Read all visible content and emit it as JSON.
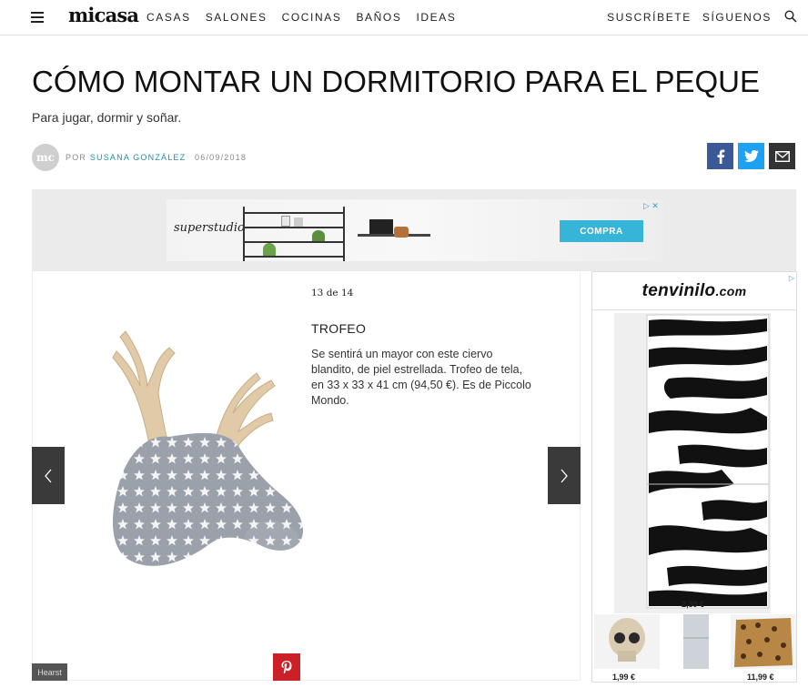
{
  "header": {
    "logo": "micasa",
    "nav": [
      "CASAS",
      "SALONES",
      "COCINAS",
      "BAÑOS",
      "IDEAS"
    ],
    "right_nav": [
      "SUSCRÍBETE",
      "SÍGUENOS"
    ]
  },
  "article": {
    "title": "CÓMO MONTAR UN DORMITORIO PARA EL PEQUE",
    "subtitle": "Para jugar, dormir y soñar.",
    "avatar_text": "mc",
    "by_prefix": "POR",
    "author": "SUSANA GONZÁLEZ",
    "date": "06/09/2018"
  },
  "ad_banner": {
    "brand": "superstudio",
    "button": "COMPRA"
  },
  "gallery": {
    "counter": "13 de 14",
    "title": "TROFEO",
    "description": "Se sentirá un mayor con este ciervo blandito, de piel estrellada. Trofeo de tela, en 33 x 33 x 41 cm (94,50 €). Es de Piccolo Mondo.",
    "credit": "Hearst"
  },
  "side_ad": {
    "brand": "tenvinilo",
    "brand_suffix": ".com",
    "main_price": "2,39 €",
    "thumb_prices": [
      "1,99 €",
      "11,99 €"
    ]
  },
  "colors": {
    "facebook": "#3b5998",
    "twitter": "#1da1f2",
    "pinterest": "#cb2027",
    "author_link": "#1f8fa3",
    "ad_button": "#36b5d8"
  }
}
